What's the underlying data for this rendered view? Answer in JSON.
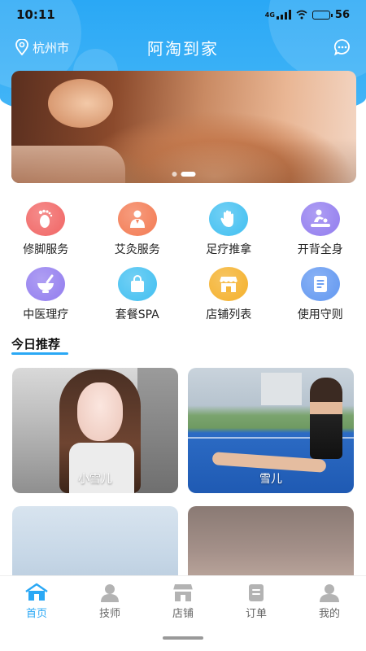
{
  "status_bar": {
    "time": "10:11",
    "network": "4G",
    "battery": "56",
    "battery_level": 0.56
  },
  "header": {
    "location": "杭州市",
    "title": "阿淘到家"
  },
  "banner": {
    "active_index": 1,
    "count": 2
  },
  "services": [
    {
      "label": "修脚服务",
      "icon": "foot-icon",
      "color": "#f2706f"
    },
    {
      "label": "艾灸服务",
      "icon": "moxibustion-icon",
      "color": "#f4845f"
    },
    {
      "label": "足疗推拿",
      "icon": "hand-icon",
      "color": "#4fc4f2"
    },
    {
      "label": "开背全身",
      "icon": "massage-icon",
      "color": "#9a86f0"
    },
    {
      "label": "中医理疗",
      "icon": "mortar-icon",
      "color": "#9a86f0"
    },
    {
      "label": "套餐SPA",
      "icon": "bag-icon",
      "color": "#4fc4f2"
    },
    {
      "label": "店铺列表",
      "icon": "store-icon",
      "color": "#f5b63a"
    },
    {
      "label": "使用守则",
      "icon": "document-icon",
      "color": "#6d9ff2"
    }
  ],
  "recommend": {
    "title": "今日推荐",
    "cards": [
      {
        "name": "小雪儿"
      },
      {
        "name": "雪儿"
      },
      {
        "name": ""
      },
      {
        "name": ""
      }
    ]
  },
  "tabbar": {
    "active": "home",
    "items": [
      {
        "label": "首页",
        "icon": "home-icon"
      },
      {
        "label": "技师",
        "icon": "technician-icon"
      },
      {
        "label": "店铺",
        "icon": "store-icon"
      },
      {
        "label": "订单",
        "icon": "order-icon"
      },
      {
        "label": "我的",
        "icon": "profile-icon"
      }
    ]
  },
  "colors": {
    "accent": "#2aa8f5",
    "tab_inactive": "#b3b3b3"
  }
}
